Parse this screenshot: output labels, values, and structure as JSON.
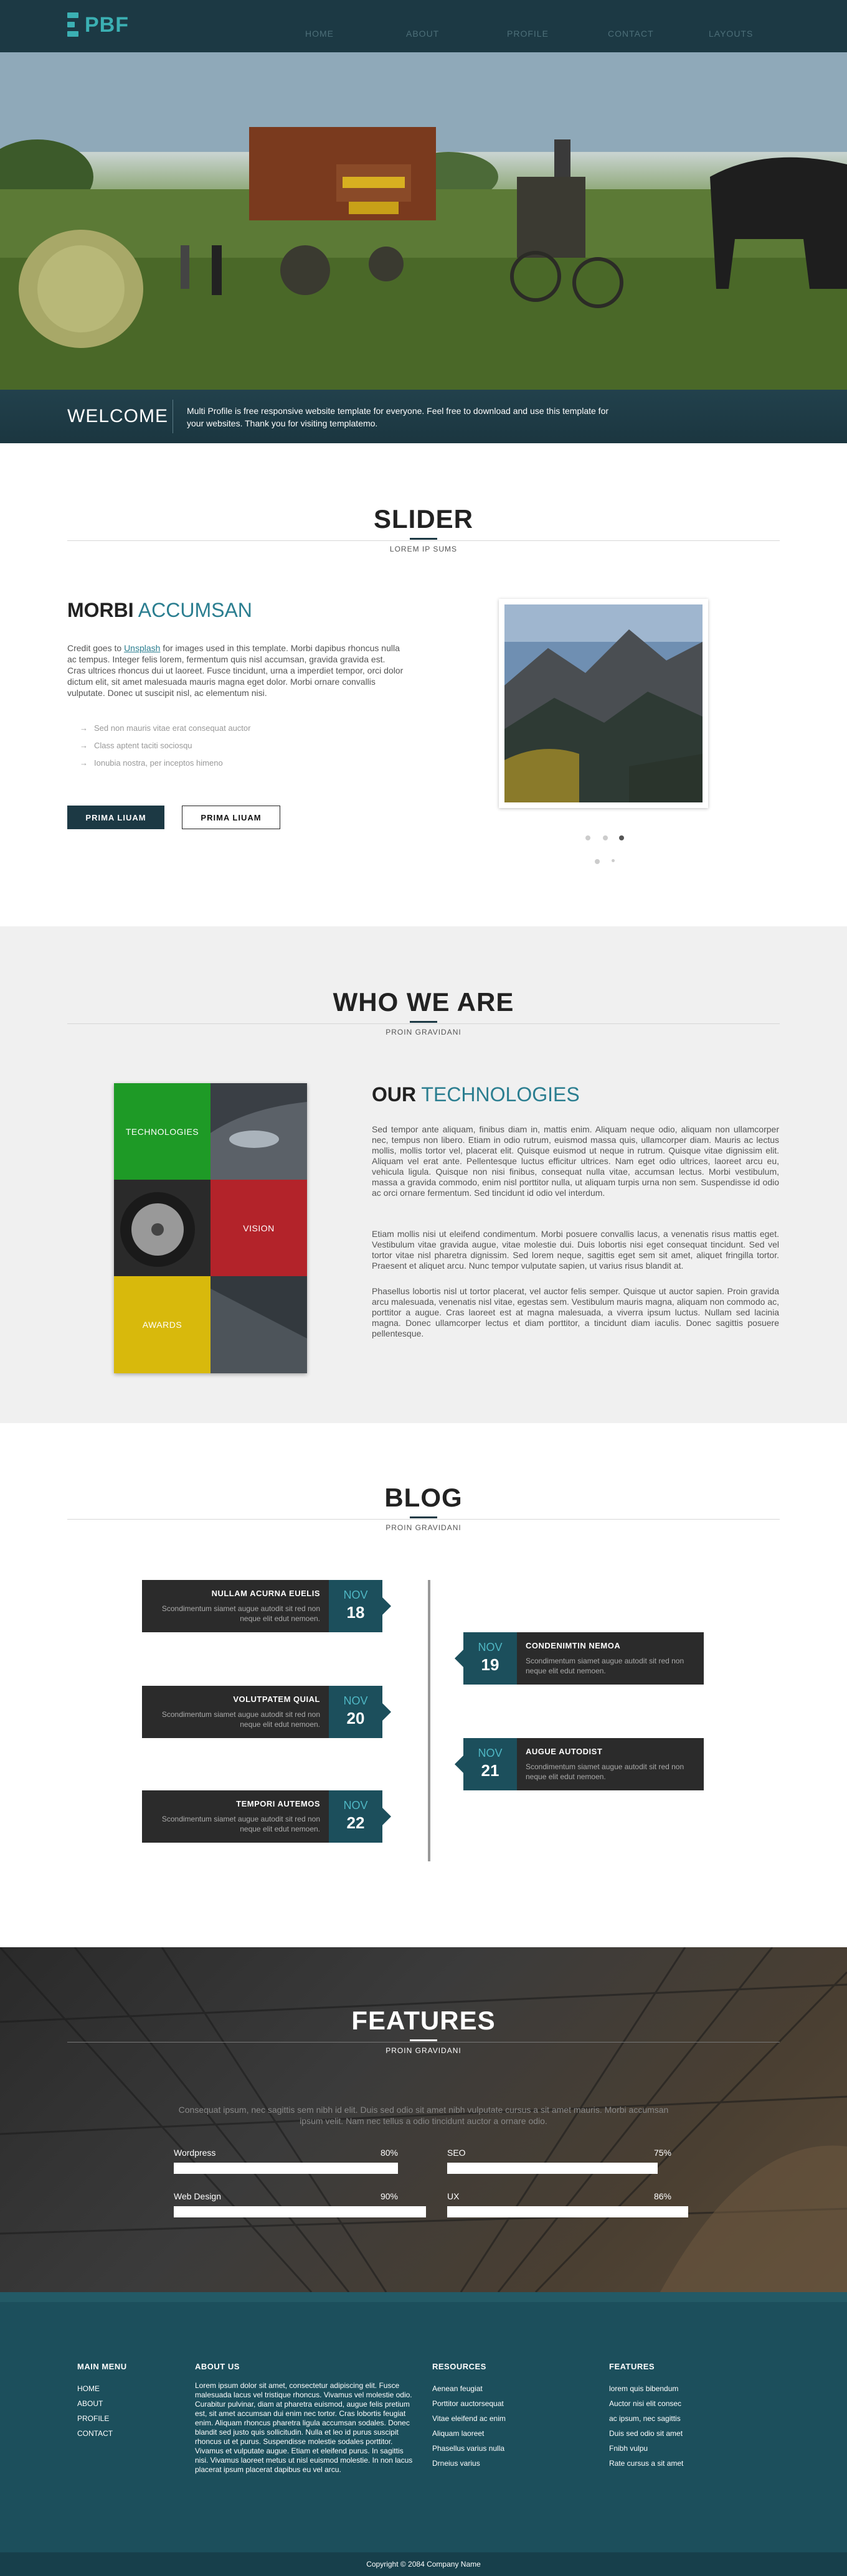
{
  "header": {
    "logo": "PBF",
    "nav": [
      "HOME",
      "ABOUT",
      "PROFILE",
      "CONTACT",
      "LAYOUTS"
    ]
  },
  "welcome": {
    "title": "WELCOME",
    "text": "Multi Profile is free responsive website template for everyone. Feel free to download and use this template for your websites. Thank you for visiting templatemo."
  },
  "slider": {
    "title": "SLIDER",
    "subtitle": "LOREM IP SUMS",
    "heading_bold": "MORBI",
    "heading_light": "ACCUMSAN",
    "text_prefix": "Credit goes to",
    "text_link": "Unsplash",
    "text_body": "for images used in this template. Morbi dapibus rhoncus nulla ac tempus. Integer felis lorem, fermentum quis nisl accumsan, gravida gravida est. Cras ultrices rhoncus dui ut laoreet. Fusce tincidunt, urna a imperdiet tempor, orci dolor dictum elit, sit amet malesuada mauris magna eget dolor. Morbi ornare convallis vulputate. Donec ut suscipit nisl, ac elementum nisi.",
    "bullets": [
      "Sed non mauris vitae erat consequat auctor",
      "Class aptent taciti sociosqu",
      "Ionubia nostra, per inceptos himeno"
    ],
    "button1": "PRIMA LIUAM",
    "button2": "PRIMA LIUAM"
  },
  "who": {
    "title": "WHO WE ARE",
    "subtitle": "PROIN GRAVIDANI",
    "tiles": [
      "TECHNOLOGIES",
      "VISION",
      "AWARDS"
    ],
    "heading_bold": "OUR",
    "heading_light": "TECHNOLOGIES",
    "p1": "Sed tempor ante aliquam, finibus diam in, mattis enim. Aliquam neque odio, aliquam non ullamcorper nec, tempus non libero. Etiam in odio rutrum, euismod massa quis, ullamcorper diam. Mauris ac lectus mollis, mollis tortor vel, placerat elit. Quisque euismod ut neque in rutrum. Quisque vitae dignissim elit. Aliquam vel erat ante. Pellentesque luctus efficitur ultrices. Nam eget odio ultrices, laoreet arcu eu, vehicula ligula. Quisque non nisi finibus, consequat nulla vitae, accumsan lectus. Morbi vestibulum, massa a gravida commodo, enim nisl porttitor nulla, ut aliquam turpis urna non sem. Suspendisse id odio ac orci ornare fermentum. Sed tincidunt id odio vel interdum.",
    "p2": "Etiam mollis nisi ut eleifend condimentum. Morbi posuere convallis lacus, a venenatis risus mattis eget. Vestibulum vitae gravida augue, vitae molestie dui. Duis lobortis nisi eget consequat tincidunt. Sed vel tortor vitae nisl pharetra dignissim. Sed lorem neque, sagittis eget sem sit amet, aliquet fringilla tortor. Praesent et aliquet arcu. Nunc tempor vulputate sapien, ut varius risus blandit at.",
    "p3": "Phasellus lobortis nisl ut tortor placerat, vel auctor felis semper. Quisque ut auctor sapien. Proin gravida arcu malesuada, venenatis nisl vitae, egestas sem. Vestibulum mauris magna, aliquam non commodo ac, porttitor a augue. Cras laoreet est at magna malesuada, a viverra ipsum luctus. Nullam sed lacinia magna. Donec ullamcorper lectus et diam porttitor, a tincidunt diam iaculis. Donec sagittis posuere pellentesque."
  },
  "blog": {
    "title": "BLOG",
    "subtitle": "PROIN GRAVIDANI",
    "posts": [
      {
        "title": "NULLAM ACURNA EUELIS",
        "desc": "Scondimentum siamet augue autodit sit red non neque elit edut nemoen.",
        "month": "NOV",
        "day": "18"
      },
      {
        "title": "CONDENIMTIN NEMOA",
        "desc": "Scondimentum siamet augue autodit sit red non neque elit edut nemoen.",
        "month": "NOV",
        "day": "19"
      },
      {
        "title": "VOLUTPATEM QUIAL",
        "desc": "Scondimentum siamet augue autodit sit red non neque elit edut nemoen.",
        "month": "NOV",
        "day": "20"
      },
      {
        "title": "AUGUE AUTODIST",
        "desc": "Scondimentum siamet augue autodit sit red non neque elit edut nemoen.",
        "month": "NOV",
        "day": "21"
      },
      {
        "title": "TEMPORI AUTEMOS",
        "desc": "Scondimentum siamet augue autodit sit red non neque elit edut nemoen.",
        "month": "NOV",
        "day": "22"
      }
    ]
  },
  "features": {
    "title": "FEATURES",
    "subtitle": "PROIN GRAVIDANI",
    "intro": "Consequat ipsum, nec sagittis sem nibh id elit. Duis sed odio sit amet nibh vulputate cursus a sit amet mauris. Morbi accumsan ipsum velit. Nam nec tellus a odio tincidunt auctor a ornare odio.",
    "skills": [
      {
        "name": "Wordpress",
        "label": "80%",
        "value": 80
      },
      {
        "name": "SEO",
        "label": "75%",
        "value": 75
      },
      {
        "name": "Web Design",
        "label": "90%",
        "value": 90
      },
      {
        "name": "UX",
        "label": "86%",
        "value": 86
      }
    ]
  },
  "footer": {
    "main_menu": {
      "title": "MAIN MENU",
      "items": [
        "HOME",
        "ABOUT",
        "PROFILE",
        "CONTACT"
      ]
    },
    "about": {
      "title": "ABOUT US",
      "text": "Lorem ipsum dolor sit amet, consectetur adipiscing elit. Fusce malesuada lacus vel tristique rhoncus. Vivamus vel molestie odio. Curabitur pulvinar, diam at pharetra euismod, augue felis pretium est, sit amet accumsan dui enim nec tortor. Cras lobortis feugiat enim. Aliquam rhoncus pharetra ligula accumsan sodales. Donec blandit sed justo quis sollicitudin. Nulla et leo id purus suscipit rhoncus ut et purus. Suspendisse molestie sodales porttitor. Vivamus et vulputate augue. Etiam et eleifend purus. In sagittis nisi. Vivamus laoreet metus ut nisl euismod molestie. In non lacus placerat ipsum placerat dapibus eu vel arcu."
    },
    "resources": {
      "title": "RESOURCES",
      "items": [
        "Aenean feugiat",
        "Porttitor auctorsequat",
        "Vitae eleifend ac enim",
        "Aliquam laoreet",
        "Phasellus varius nulla",
        "Drneius varius"
      ]
    },
    "features": {
      "title": "FEATURES",
      "items": [
        "lorem quis bibendum",
        "Auctor nisi elit consec",
        "ac ipsum, nec sagittis",
        "Duis sed odio sit amet",
        "Fnibh vulpu",
        "Rate cursus a sit amet"
      ]
    },
    "copyright": "Copyright © 2084 Company Name"
  }
}
